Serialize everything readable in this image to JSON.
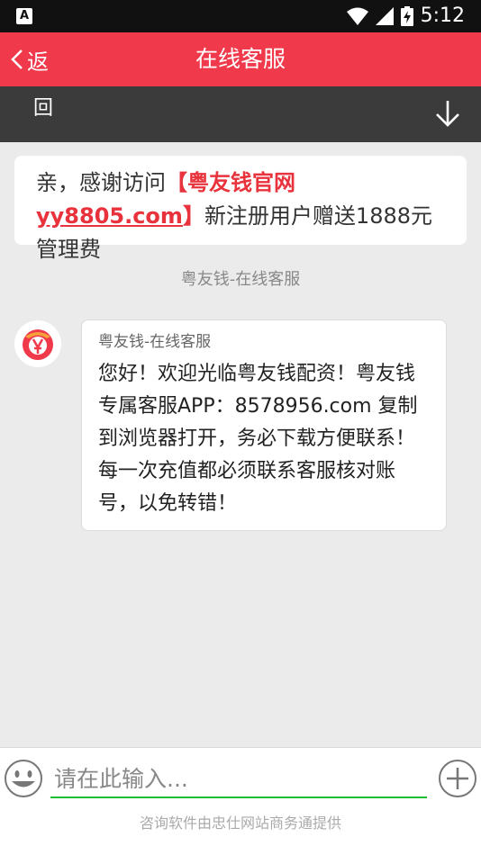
{
  "status_bar": {
    "time": "5:12",
    "notification_icon_letter": "A",
    "icons": [
      "wifi-icon",
      "signal-icon",
      "battery-charging-icon"
    ]
  },
  "header": {
    "back_label": "返",
    "title": "在线客服"
  },
  "subbar": {
    "label": "回",
    "icon": "arrow-down-icon"
  },
  "notice": {
    "prefix": "亲，感谢访问",
    "highlight_bracket_open": "【粤友钱官网 ",
    "highlight_url": "yy8805.com",
    "highlight_bracket_close": "】",
    "suffix": "新注册用户赠送1888元管理费"
  },
  "system_name": "粤友钱-在线客服",
  "message": {
    "sender": "粤友钱-在线客服",
    "text": "您好！欢迎光临粤友钱配资！粤友钱专属客服APP：8578956.com  复制到浏览器打开，务必下载方便联系！每一次充值都必须联系客服核对账号，以免转错！"
  },
  "input_bar": {
    "placeholder": "请在此输入...",
    "footer": "咨询软件由忠仕网站商务通提供"
  },
  "colors": {
    "brand": "#f03a4c",
    "highlight": "#e8333d",
    "input_underline": "#1dbd38"
  }
}
